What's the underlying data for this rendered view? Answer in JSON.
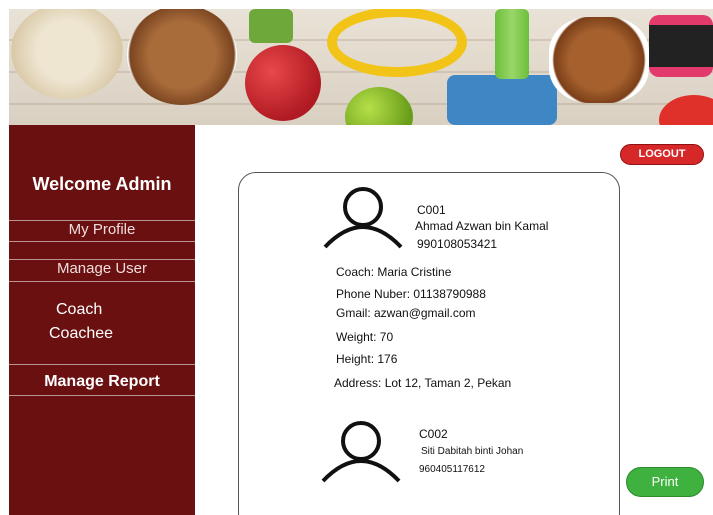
{
  "sidebar": {
    "welcome": "Welcome Admin",
    "my_profile": "My Profile",
    "manage_user": "Manage User",
    "coach": "Coach",
    "coachee": "Coachee",
    "manage_report": "Manage Report"
  },
  "header": {
    "logout_label": "LOGOUT"
  },
  "records": [
    {
      "id": "C001",
      "name": "Ahmad Azwan  bin Kamal",
      "ic": "990108053421",
      "coach": "Coach: Maria Cristine",
      "phone": "Phone Nuber: 01138790988",
      "gmail": "Gmail: azwan@gmail.com",
      "weight": "Weight: 70",
      "height": "Height: 176",
      "address": "Address: Lot 12, Taman 2, Pekan"
    },
    {
      "id": "C002",
      "name": "Siti Dabitah binti Johan",
      "ic": "960405117612"
    }
  ],
  "actions": {
    "print_label": "Print"
  },
  "colors": {
    "sidebar": "#6a1010",
    "logout": "#d62828",
    "print": "#3fb13f"
  }
}
